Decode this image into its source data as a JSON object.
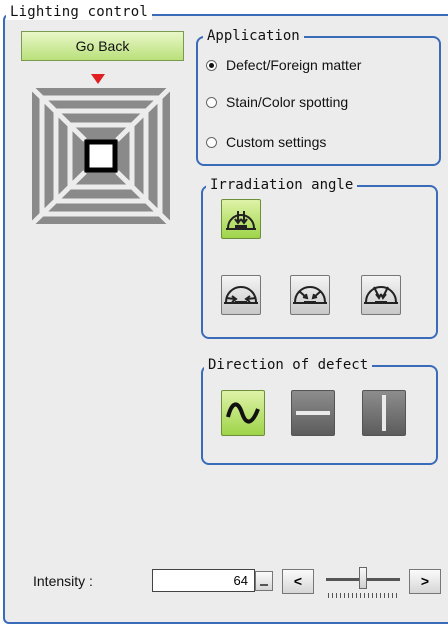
{
  "panel": {
    "title": "Lighting control"
  },
  "go_back_label": "Go Back",
  "application": {
    "title": "Application",
    "options": [
      {
        "label": "Defect/Foreign matter",
        "selected": true
      },
      {
        "label": "Stain/Color spotting",
        "selected": false
      },
      {
        "label": "Custom settings",
        "selected": false
      }
    ]
  },
  "irradiation": {
    "title": "Irradiation angle",
    "selected_index": 0
  },
  "direction": {
    "title": "Direction of defect",
    "selected_index": 0
  },
  "intensity": {
    "label": "Intensity :",
    "value": "64",
    "decrement": "<",
    "increment": ">",
    "slider_fraction": 0.5
  },
  "colors": {
    "border": "#3a6bb8",
    "selected_green": "#9ed449",
    "indicator_red": "#e02020",
    "light_grey": "#8a8a8a"
  }
}
